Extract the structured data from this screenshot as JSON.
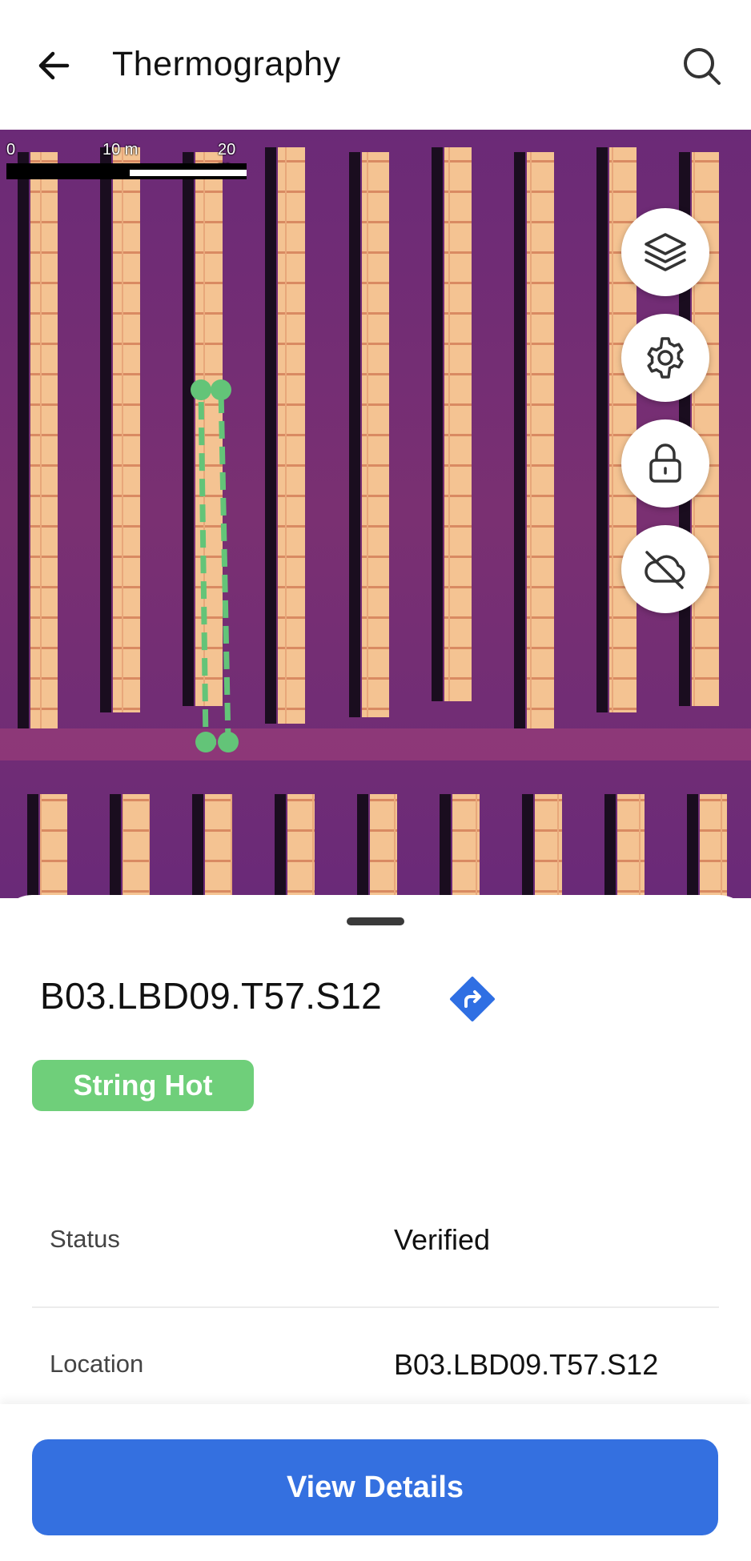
{
  "header": {
    "title": "Thermography"
  },
  "map": {
    "scale_labels": [
      "0",
      "10 m",
      "20 m"
    ],
    "controls": [
      "layers-icon",
      "gear-icon",
      "lock-icon",
      "cloud-off-icon"
    ]
  },
  "sheet": {
    "asset_id": "B03.LBD09.T57.S12",
    "badge": "String Hot",
    "badge_color": "#6fcf7a",
    "details": [
      {
        "label": "Status",
        "value": "Verified"
      },
      {
        "label": "Location",
        "value": "B03.LBD09.T57.S12"
      }
    ]
  },
  "footer": {
    "button_label": "View Details",
    "button_color": "#3470e0"
  }
}
